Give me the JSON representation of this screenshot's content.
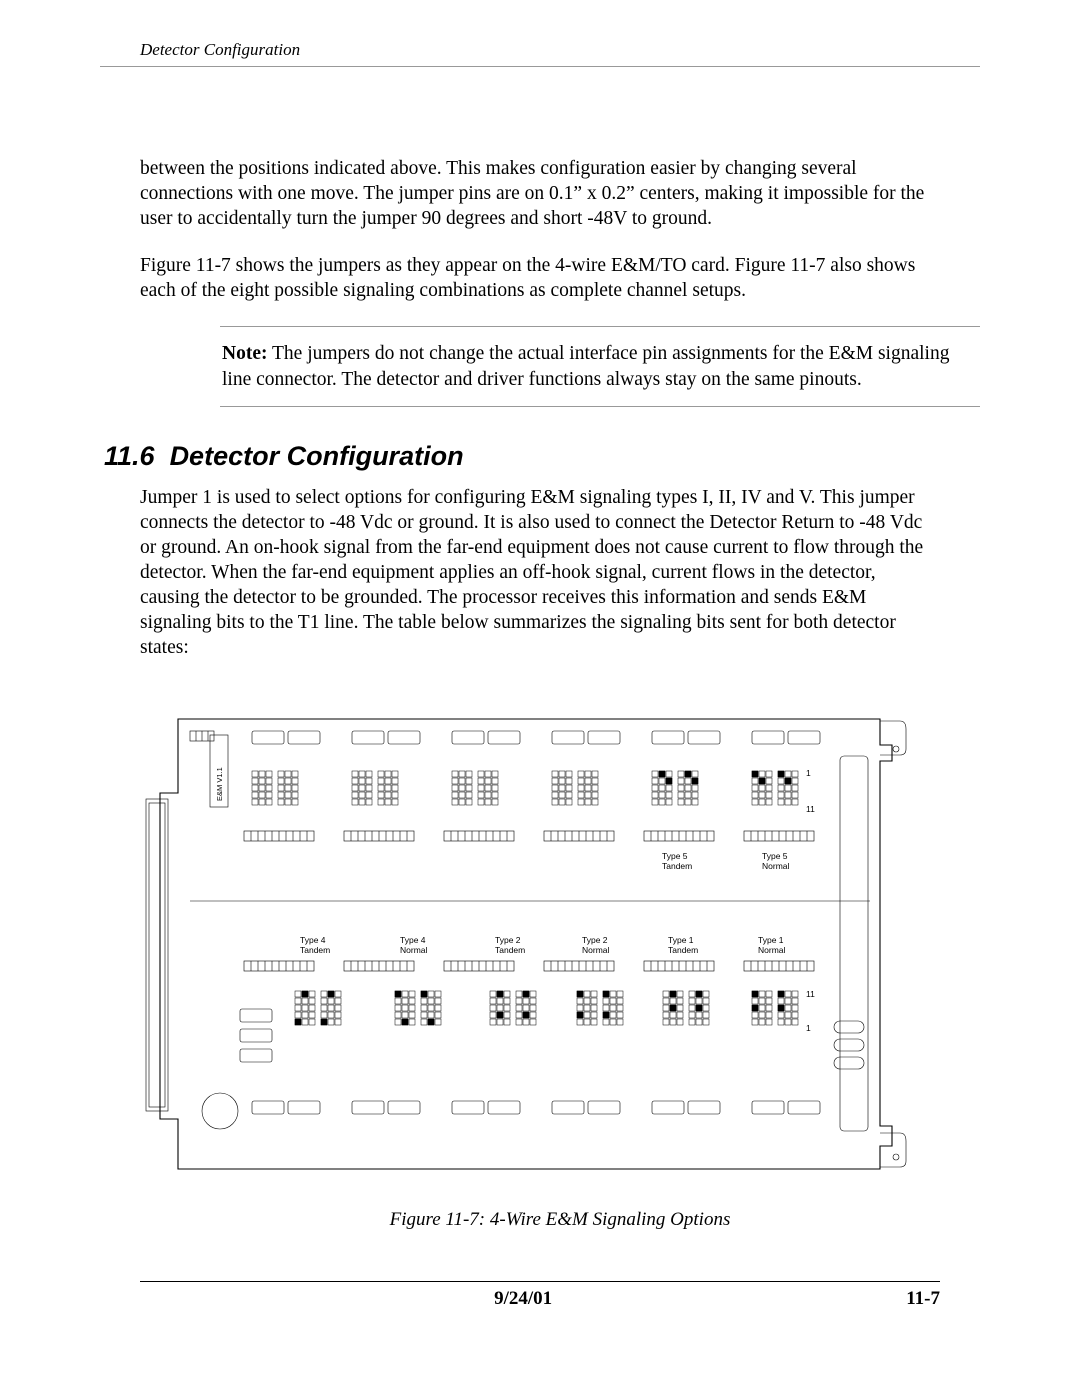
{
  "running_head": "Detector Configuration",
  "para1": "between the positions indicated above. This makes configuration easier by changing several connections with one move. The jumper pins are on 0.1” x 0.2” centers, making it impossible for the user to accidentally turn the jumper 90 degrees and short -48V to ground.",
  "para2": "Figure 11-7 shows the jumpers as they appear on the 4-wire E&M/TO card. Figure 11-7 also shows each of the eight possible signaling combinations as complete channel setups.",
  "note_label": "Note:",
  "note_text": "  The jumpers do not change the actual interface pin assignments for the E&M signaling line connector. The detector and driver functions always stay on the same pinouts.",
  "section_no": "11.6",
  "section_title": "Detector Configuration",
  "para3": "Jumper 1 is used to select options for configuring E&M signaling types I, II, IV and V. This jumper connects the detector to -48 Vdc or ground. It is also used to connect the Detector Return to -48 Vdc or ground. An on-hook signal from the far-end equipment does not cause current to flow through the detector. When the far-end equipment applies an off-hook signal, current flows in the detector, causing the detector to be grounded. The processor receives this information and sends E&M signaling bits to the T1 line. The table below summarizes the signaling bits sent for both detector states:",
  "figure_caption": "Figure 11-7: 4-Wire E&M Signaling Options",
  "chip_label": "E&M V1.1",
  "pin_1": "1",
  "pin_11": "11",
  "labels_bottom": [
    {
      "l1": "Type 4",
      "l2": "Tandem"
    },
    {
      "l1": "Type 4",
      "l2": "Normal"
    },
    {
      "l1": "Type 2",
      "l2": "Tandem"
    },
    {
      "l1": "Type 2",
      "l2": "Normal"
    },
    {
      "l1": "Type 1",
      "l2": "Tandem"
    },
    {
      "l1": "Type 1",
      "l2": "Normal"
    }
  ],
  "labels_top": [
    {
      "l1": "Type 5",
      "l2": "Tandem"
    },
    {
      "l1": "Type 5",
      "l2": "Normal"
    }
  ],
  "footer_date": "9/24/01",
  "footer_page": "11-7"
}
